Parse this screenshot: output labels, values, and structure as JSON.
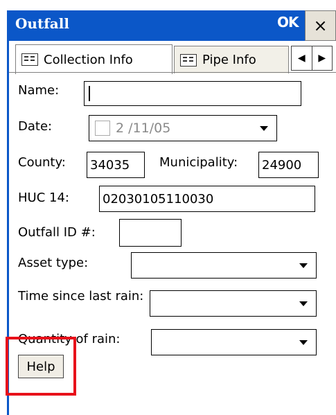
{
  "window": {
    "title": "Outfall",
    "ok_label": "OK",
    "close_label": "×"
  },
  "tabs": [
    {
      "label": "Collection Info",
      "icon": "table-icon",
      "active": true
    },
    {
      "label": "Pipe Info",
      "icon": "table-icon",
      "active": false
    }
  ],
  "tab_scroll": {
    "left": "◀",
    "right": "▶"
  },
  "form": {
    "name_label": "Name:",
    "name_value": "",
    "date_label": "Date:",
    "date_value": "2 /11/05",
    "county_label": "County:",
    "county_value": "34035",
    "municipality_label": "Municipality:",
    "municipality_value": "24900",
    "huc_label": "HUC 14:",
    "huc_value": "02030105110030",
    "outfall_id_label": "Outfall ID #:",
    "outfall_id_value": "",
    "asset_type_label": "Asset type:",
    "asset_type_value": "",
    "time_since_label": "Time since last rain:",
    "time_since_value": "",
    "quantity_label": "Quantity of rain:",
    "quantity_value": ""
  },
  "help_label": "Help",
  "colors": {
    "titlebar": "#0b57c8",
    "highlight": "#e8101a"
  }
}
